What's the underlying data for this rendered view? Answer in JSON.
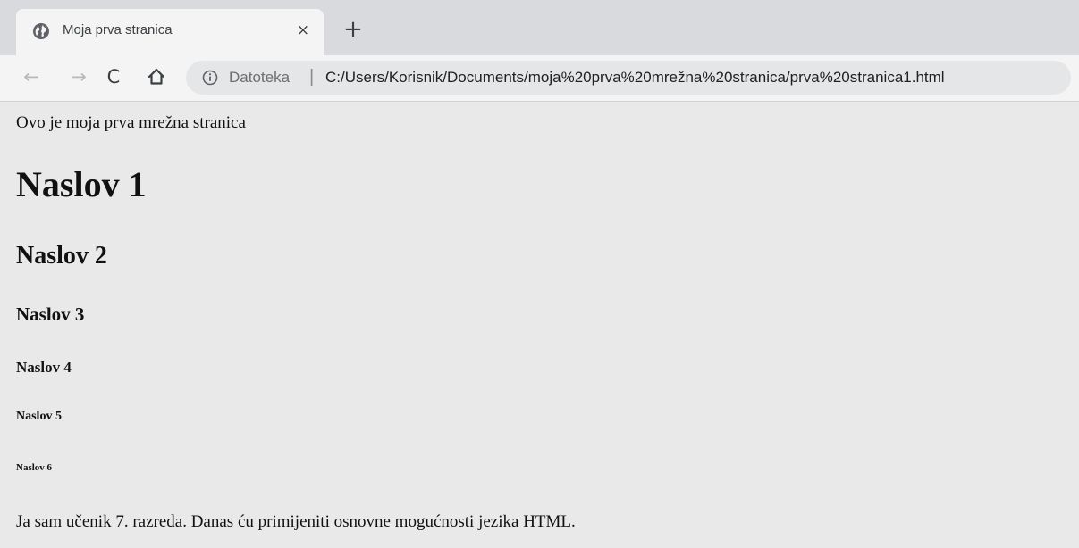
{
  "tab": {
    "title": "Moja prva stranica",
    "close_label": "×",
    "favicon": "globe-icon"
  },
  "tabstrip": {
    "new_tab_label": "+"
  },
  "toolbar": {
    "back_label": "←",
    "forward_label": "→",
    "reload_label": "C",
    "home_icon": "home-icon"
  },
  "omnibox": {
    "info_icon": "info-icon",
    "scheme_label": "Datoteka",
    "separator": "|",
    "url": "C:/Users/Korisnik/Documents/moja%20prva%20mrežna%20stranica/prva%20stranica1.html"
  },
  "page": {
    "intro": "Ovo je moja prva mrežna stranica",
    "h1": "Naslov 1",
    "h2": "Naslov 2",
    "h3": "Naslov 3",
    "h4": "Naslov 4",
    "h5": "Naslov 5",
    "h6": "Naslov 6",
    "outro": "Ja sam učenik 7. razreda. Danas ću primijeniti osnovne mogućnosti jezika HTML."
  },
  "colors": {
    "tabstrip_bg": "#d8dadd",
    "toolbar_bg": "#f4f4f4",
    "omnibox_bg": "#e5e6e8",
    "page_bg": "#e9e9e9",
    "text": "#111111"
  }
}
